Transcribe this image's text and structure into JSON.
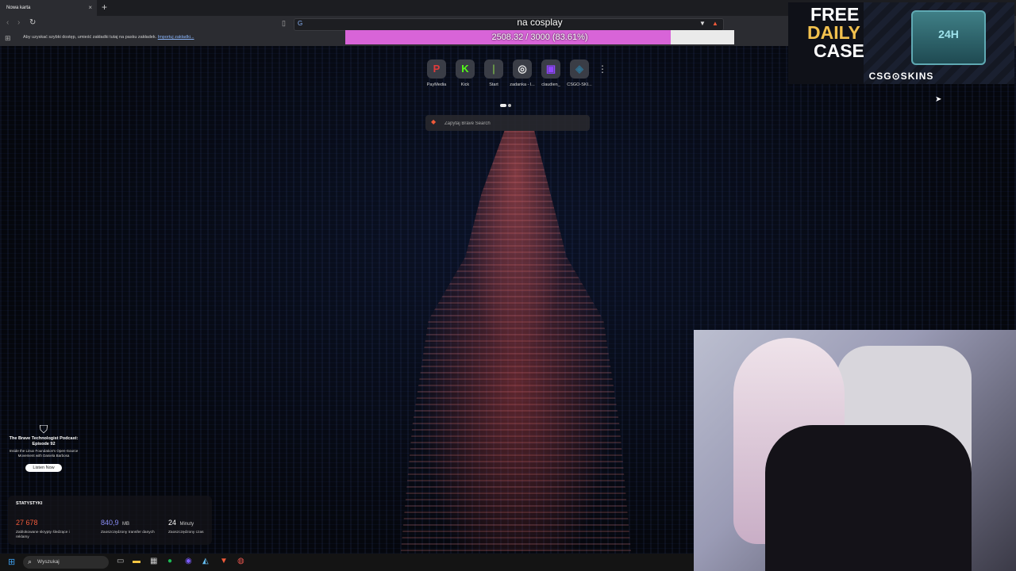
{
  "browser": {
    "tab_title": "Nowa karta",
    "tab_close": "×",
    "new_tab": "+",
    "search_placeholder": "Zapytaj Brave Search",
    "bookmarks_hint": "Aby uzyskać szybki dostęp, umieść zakładki tutaj na pasku zakładek.",
    "bookmarks_import": "Importuj zakładki..."
  },
  "overlay": {
    "goal_title": "na cosplay",
    "goal_text": "2508.32 / 3000 (83.61%)",
    "goal_progress": 0.8361
  },
  "shortcuts": [
    {
      "label": "PayMedia",
      "glyph": "P",
      "color": "#e23b3b"
    },
    {
      "label": "Kick",
      "glyph": "K",
      "color": "#53fc18"
    },
    {
      "label": "Start",
      "glyph": "|",
      "color": "#6ea04a"
    },
    {
      "label": "zadanka - l...",
      "glyph": "◎",
      "color": "#e6e6e6"
    },
    {
      "label": "claudien_",
      "glyph": "▣",
      "color": "#9146ff"
    },
    {
      "label": "CSGO-SKI...",
      "glyph": "◈",
      "color": "#2f6f8f"
    }
  ],
  "ad": {
    "line1": "FREE",
    "line2": "DAILY",
    "line3": "CASE",
    "chest_label": "24H",
    "logo": "CSG⊙SKINS"
  },
  "podcast": {
    "title": "The Brave Technologist Podcast: Episode 92",
    "description": "Inside the Linux Foundation's Open-Source Movement with Daniela Barbosa",
    "button": "Listen Now"
  },
  "stats": {
    "title": "STATYSTYKI",
    "items": [
      {
        "value": "27 678",
        "unit": "",
        "desc": "Zablokowane skrypty śledzące i reklamy",
        "color": "#f15a3a"
      },
      {
        "value": "840,9",
        "unit": "MB",
        "desc": "Zaoszczędzony transfer danych",
        "color": "#8a8df7"
      },
      {
        "value": "24",
        "unit": "Minuty",
        "desc": "Zaoszczędzony czas",
        "color": "#ffffff"
      }
    ]
  },
  "taskbar": {
    "search_label": "Wyszukaj"
  }
}
